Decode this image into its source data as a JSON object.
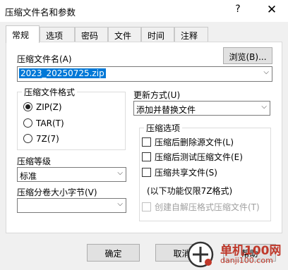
{
  "window": {
    "title": "压缩文件名和参数",
    "help_glyph": "?",
    "close_glyph": "✕"
  },
  "tabs": [
    "常规",
    "选项",
    "密码",
    "文件",
    "时间",
    "注释"
  ],
  "general": {
    "archive_name_label": "压缩文件名(A)",
    "browse_label": "浏览(B)...",
    "archive_name_value": "2023_20250725.zip",
    "format_group_title": "压缩文件格式",
    "formats": [
      {
        "label": "ZIP(Z)",
        "checked": true
      },
      {
        "label": "TAR(T)",
        "checked": false
      },
      {
        "label": "7Z(7)",
        "checked": false
      }
    ],
    "update_mode_label": "更新方式(U)",
    "update_mode_value": "添加并替换文件",
    "level_label": "压缩等级",
    "level_value": "标准",
    "split_label": "压缩分卷大小字节(V)",
    "split_value": "",
    "options_group_title": "压缩选项",
    "options": [
      {
        "label": "压缩后删除源文件(L)",
        "checked": false,
        "enabled": true
      },
      {
        "label": "压缩后测试压缩文件(E)",
        "checked": false,
        "enabled": true
      },
      {
        "label": "压缩共享文件(S)",
        "checked": false,
        "enabled": true
      }
    ],
    "note_7z": "(以下功能仅限7Z格式)",
    "sfx_option": {
      "label": "创建自解压格式压缩文件(T)",
      "checked": false,
      "enabled": false
    }
  },
  "footer": {
    "ok_label": "确定",
    "cancel_label": "取消",
    "help_label": "帮助"
  },
  "watermark": {
    "line1": "单机100网",
    "line2": "danji100.com"
  },
  "colors": {
    "selection": "#0078d7",
    "accent": "#c0392b"
  }
}
